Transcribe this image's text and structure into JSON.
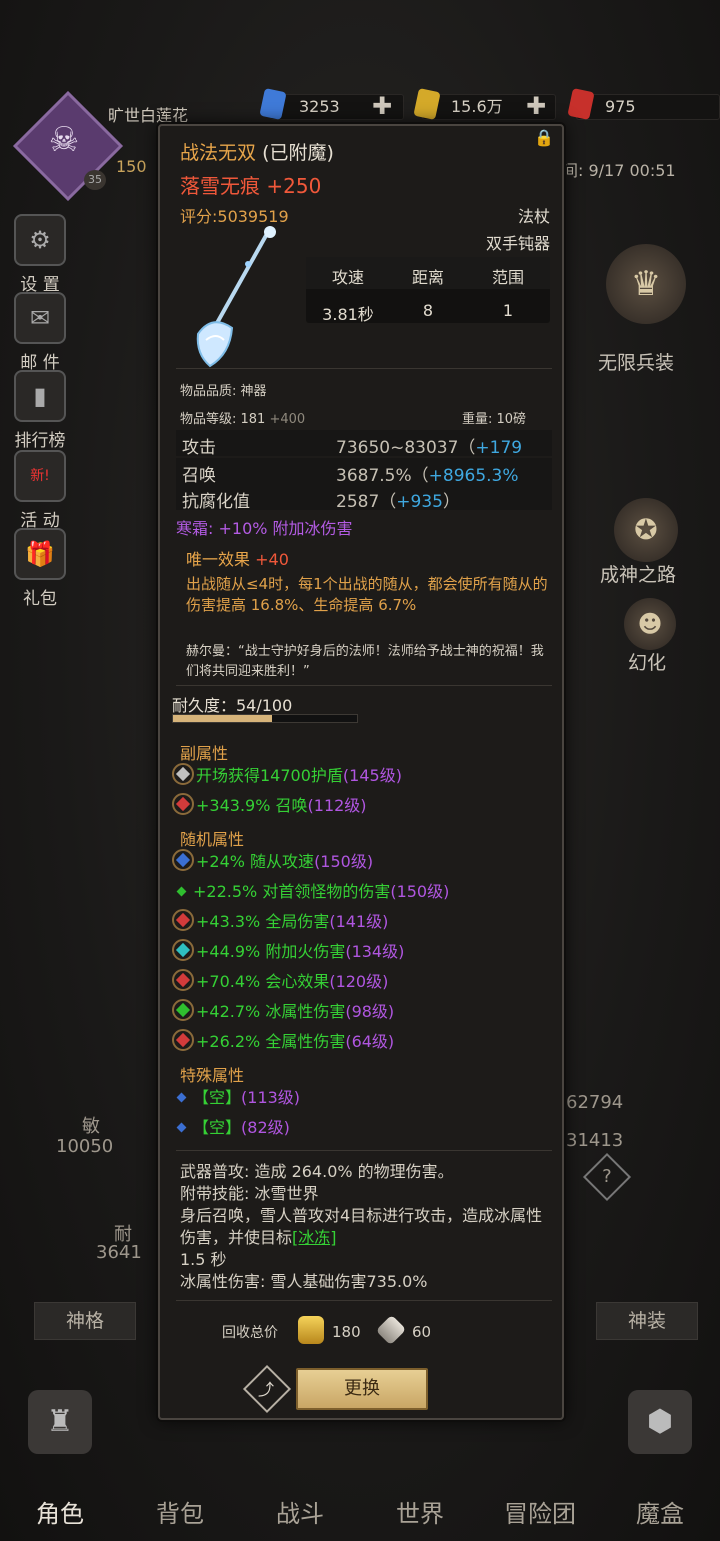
{
  "player": {
    "name": "旷世白莲花",
    "level_text": "150",
    "badge": "35"
  },
  "resources": [
    {
      "value": "3253",
      "color": "#3f7ad8"
    },
    {
      "value": "15.6万",
      "color": "#d4a929"
    },
    {
      "value": "975",
      "color": "#c7302b"
    }
  ],
  "time_text": "间: 9/17 00:51",
  "left_menu": [
    {
      "label": "设 置",
      "icon": "gear-icon"
    },
    {
      "label": "邮 件",
      "icon": "mail-icon"
    },
    {
      "label": "排行榜",
      "icon": "ranking-icon"
    },
    {
      "label": "活 动",
      "icon": "event-icon",
      "badge": "新!"
    },
    {
      "label": "礼包",
      "icon": "gift-icon"
    }
  ],
  "right_menu": [
    {
      "label": "无限兵装",
      "icon": "armory-icon"
    },
    {
      "label": "成神之路",
      "icon": "path-icon"
    },
    {
      "label": "幻化",
      "icon": "transform-icon"
    }
  ],
  "bg_stats": {
    "min_label": "敏",
    "min_value": "10050",
    "nai_label": "耐",
    "nai_value": "3641",
    "r1": "62794",
    "r2": "31413"
  },
  "low_buttons": {
    "left": "神格",
    "right": "神装"
  },
  "item": {
    "name": "战法无双",
    "enchanted": "(已附魔)",
    "suffix": "落雪无痕 +250",
    "score": "评分:5039519",
    "type": "法杖",
    "subtype": "双手钝器",
    "table_headers": [
      "攻速",
      "距离",
      "范围"
    ],
    "table_values": [
      "3.81秒",
      "8",
      "1"
    ],
    "quality": "物品品质: 神器",
    "level_label": "物品等级: 181",
    "level_bonus": "+400",
    "weight": "重量: 10磅",
    "stats": [
      {
        "key": "攻击",
        "value": "73650~83037（",
        "bonus": "+179"
      },
      {
        "key": "召唤",
        "value": "3687.5%（",
        "bonus": "+8965.3%"
      },
      {
        "key": "抗腐化值",
        "value": "2587（",
        "bonus": "+935",
        "close": "）"
      }
    ],
    "enchant": "寒霜: +10% 附加冰伤害",
    "unique_title": "唯一效果",
    "unique_bonus": "+40",
    "unique_body": "出战随从≤4时，每1个出战的随从，都会使所有随从的伤害提高 16.8%、生命提高 6.7%",
    "quote": "赫尔曼：“战士守护好身后的法师！法师给予战士神的祝福！我们将共同迎来胜利！”",
    "durability_label": "耐久度：54/100",
    "durability": 0.54,
    "sub_title": "副属性",
    "sub_attrs": [
      {
        "text": "开场获得14700护盾",
        "lv": "(145级)",
        "gem": "#c0c0c0"
      },
      {
        "text": "+343.9% 召唤",
        "lv": "(112级)",
        "gem": "#d23b3b"
      }
    ],
    "rand_title": "随机属性",
    "rand_attrs": [
      {
        "text": "+24% 随从攻速",
        "lv": "(150级)",
        "gem": "#3b6fd2"
      },
      {
        "text": "+22.5% 对首领怪物的伤害",
        "lv": "(150级)",
        "gem": "#2fbf2f",
        "diamond": true
      },
      {
        "text": "+43.3% 全局伤害",
        "lv": "(141级)",
        "gem": "#d23b3b"
      },
      {
        "text": "+44.9% 附加火伤害",
        "lv": "(134级)",
        "gem": "#2fbfbf"
      },
      {
        "text": "+70.4% 会心效果",
        "lv": "(120级)",
        "gem": "#d23b3b"
      },
      {
        "text": "+42.7% 冰属性伤害",
        "lv": "(98级)",
        "gem": "#2fbf2f"
      },
      {
        "text": "+26.2% 全属性伤害",
        "lv": "(64级)",
        "gem": "#d23b3b"
      }
    ],
    "special_title": "特殊属性",
    "special_attrs": [
      {
        "text": "【空】",
        "lv": "(113级)"
      },
      {
        "text": "【空】",
        "lv": "(82级)"
      }
    ],
    "desc_lines": [
      "武器普攻: 造成 264.0% 的物理伤害。",
      "附带技能: 冰雪世界",
      "身后召唤，雪人普攻对4目标进行攻击，造成冰属性伤害，并使目标",
      "[冰冻]",
      "1.5 秒",
      "冰属性伤害: 雪人基础伤害735.0%"
    ],
    "recycle_label": "回收总价",
    "recycle_gold": "180",
    "recycle_shard": "60",
    "replace_label": "更换"
  },
  "bottom_tabs": [
    "角色",
    "背包",
    "战斗",
    "世界",
    "冒险团",
    "魔盒"
  ]
}
